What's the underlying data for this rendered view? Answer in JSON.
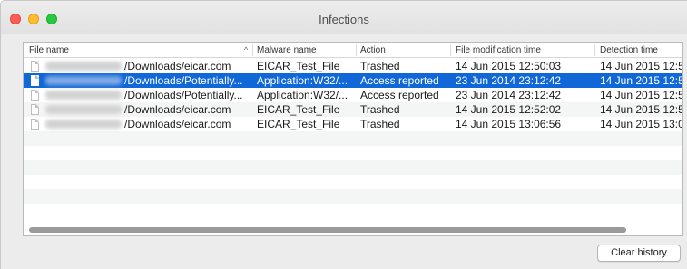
{
  "window": {
    "title": "Infections"
  },
  "table": {
    "columns": {
      "file_name": "File name",
      "malware_name": "Malware name",
      "action": "Action",
      "modification_time": "File modification time",
      "detection_time": "Detection time"
    },
    "sort_indicator": "^",
    "rows": [
      {
        "file": "/Downloads/eicar.com",
        "malware": "EICAR_Test_File",
        "action": "Trashed",
        "mtime": "14 Jun 2015 12:50:03",
        "dtime": "14 Jun 2015 12:5"
      },
      {
        "file": "/Downloads/Potentially...",
        "malware": "Application:W32/...",
        "action": "Access reported",
        "mtime": "23 Jun 2014 23:12:42",
        "dtime": "14 Jun 2015 12:5"
      },
      {
        "file": "/Downloads/Potentially...",
        "malware": "Application:W32/...",
        "action": "Access reported",
        "mtime": "23 Jun 2014 23:12:42",
        "dtime": "14 Jun 2015 12:5"
      },
      {
        "file": "/Downloads/eicar.com",
        "malware": "EICAR_Test_File",
        "action": "Trashed",
        "mtime": "14 Jun 2015 12:52:02",
        "dtime": "14 Jun 2015 12:5"
      },
      {
        "file": "/Downloads/eicar.com",
        "malware": "EICAR_Test_File",
        "action": "Trashed",
        "mtime": "14 Jun 2015 13:06:56",
        "dtime": "14 Jun 2015 13:0"
      }
    ],
    "selected_row": 1
  },
  "buttons": {
    "clear_history": "Clear history"
  },
  "colors": {
    "selection": "#1068d8",
    "zebra": "#f4f5f5"
  },
  "icons": {
    "file": "document-icon",
    "sort": "sort-ascending-icon"
  }
}
